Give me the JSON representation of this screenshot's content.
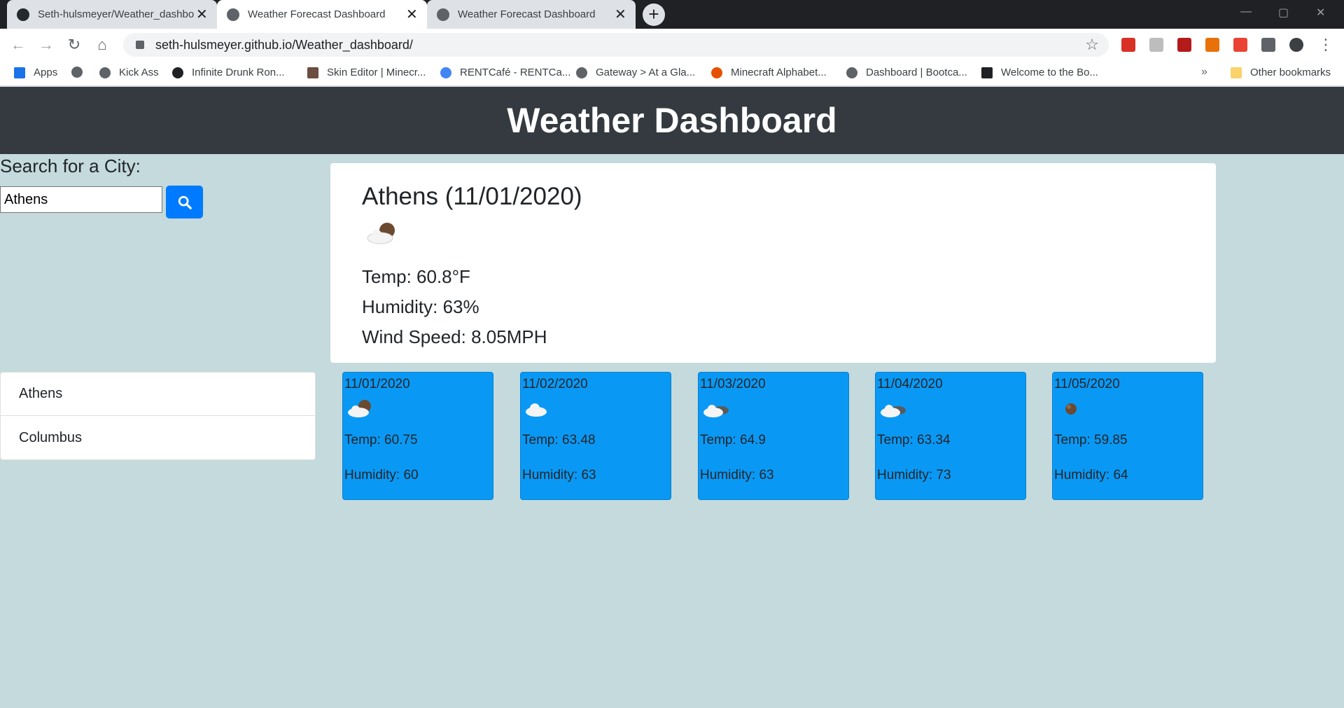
{
  "browser": {
    "tabs": [
      {
        "title": "Seth-hulsmeyer/Weather_dashbo",
        "close": "✕"
      },
      {
        "title": "Weather Forecast Dashboard",
        "close": "✕"
      },
      {
        "title": "Weather Forecast Dashboard",
        "close": "✕"
      }
    ],
    "new_tab": "+",
    "url": "seth-hulsmeyer.github.io/Weather_dashboard/",
    "bookmarks": [
      "Apps",
      "Kick Ass",
      "Infinite Drunk Ron...",
      "Skin Editor | Minecr...",
      "RENTCafé - RENTCa...",
      "Gateway > At a Gla...",
      "Minecraft Alphabet...",
      "Dashboard | Bootca...",
      "Welcome to the Bo..."
    ],
    "bookmarks_more": "»",
    "other_bookmarks": "Other bookmarks",
    "icons": [
      "back-icon",
      "forward-icon",
      "reload-icon",
      "home-icon",
      "lock-icon",
      "star-icon",
      "extensions-icon",
      "menu-icon"
    ]
  },
  "app": {
    "header_title": "Weather Dashboard",
    "search": {
      "label": "Search for a City:",
      "value": "Athens",
      "button_icon": "search-icon"
    },
    "current": {
      "title": "Athens (11/01/2020)",
      "icon": "partly-cloudy-night-icon",
      "temp": "Temp: 60.8°F",
      "humidity": "Humidity: 63%",
      "wind": "Wind Speed: 8.05MPH"
    },
    "history": [
      "Athens",
      "Columbus"
    ],
    "forecast": [
      {
        "date": "11/01/2020",
        "icon": "partly-cloudy-night-icon",
        "temp": "Temp: 60.75",
        "humidity": "Humidity: 60"
      },
      {
        "date": "11/02/2020",
        "icon": "cloud-icon",
        "temp": "Temp: 63.48",
        "humidity": "Humidity: 63"
      },
      {
        "date": "11/03/2020",
        "icon": "broken-clouds-icon",
        "temp": "Temp: 64.9",
        "humidity": "Humidity: 63"
      },
      {
        "date": "11/04/2020",
        "icon": "broken-clouds-icon",
        "temp": "Temp: 63.34",
        "humidity": "Humidity: 73"
      },
      {
        "date": "11/05/2020",
        "icon": "clear-night-icon",
        "temp": "Temp: 59.85",
        "humidity": "Humidity: 64"
      }
    ],
    "colors": {
      "header_bg": "#343a40",
      "page_bg": "#c4dadc",
      "forecast_bg": "#0999f5",
      "button_bg": "#007bff"
    }
  }
}
